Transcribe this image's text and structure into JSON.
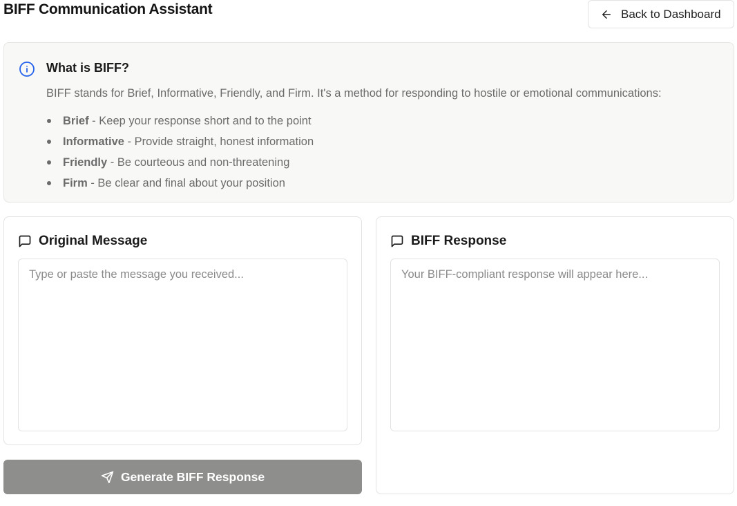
{
  "header": {
    "title": "BIFF Communication Assistant",
    "back_label": "Back to Dashboard"
  },
  "info": {
    "icon": "info-icon",
    "title": "What is BIFF?",
    "description": "BIFF stands for Brief, Informative, Friendly, and Firm. It's a method for responding to hostile or emotional communications:",
    "items": [
      {
        "term": "Brief",
        "text": " - Keep your response short and to the point"
      },
      {
        "term": "Informative",
        "text": " - Provide straight, honest information"
      },
      {
        "term": "Friendly",
        "text": " - Be courteous and non-threatening"
      },
      {
        "term": "Firm",
        "text": " - Be clear and final about your position"
      }
    ]
  },
  "original": {
    "icon": "message-square-icon",
    "title": "Original Message",
    "value": "",
    "placeholder": "Type or paste the message you received..."
  },
  "response": {
    "icon": "message-square-icon",
    "title": "BIFF Response",
    "value": "",
    "placeholder": "Your BIFF-compliant response will appear here..."
  },
  "generate": {
    "icon": "send-icon",
    "label": "Generate BIFF Response"
  },
  "colors": {
    "accent_info": "#2563eb",
    "button_disabled": "#8e8e8c",
    "card_background": "#f8f8f6"
  }
}
